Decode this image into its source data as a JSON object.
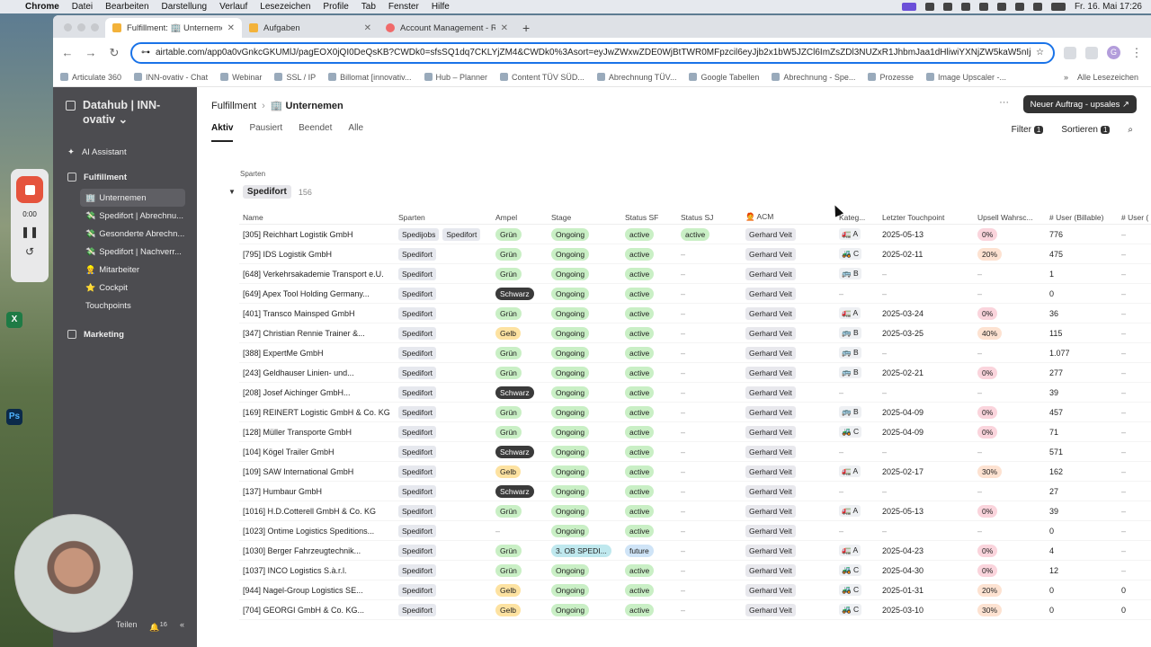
{
  "menubar": {
    "items": [
      "Chrome",
      "Datei",
      "Bearbeiten",
      "Darstellung",
      "Verlauf",
      "Lesezeichen",
      "Profile",
      "Tab",
      "Fenster",
      "Hilfe"
    ],
    "clock": "Fr. 16. Mai 17:26"
  },
  "tabs": [
    {
      "label": "Fulfillment: 🏢 Unternemen"
    },
    {
      "label": "Aufgaben"
    },
    {
      "label": "Account Management - Repo"
    }
  ],
  "url": "airtable.com/app0a0vGnkcGKUMlJ/pagEOX0jQI0DeQsKB?CWDk0=sfsSQ1dq7CKLYjZM4&CWDk0%3Asort=eyJwZWxwZDE0WjBtTWR0MFpzcil6eyJjb2x1bW5JZCl6ImZsZDl3NUZxR1JhbmJaa1dHliwiYXNjZW5kaW5nIjp0c...",
  "bookmarks": [
    "Articulate 360",
    "INN-ovativ - Chat",
    "Webinar",
    "SSL / IP",
    "Billomat [innovativ...",
    "Hub – Planner",
    "Content TÜV SÜD...",
    "Abrechnung TÜV...",
    "Google Tabellen",
    "Abrechnung - Spe...",
    "Prozesse",
    "Image Upscaler -..."
  ],
  "bookmarks_right": "Alle Lesezeichen",
  "sidebar": {
    "workspace": "Datahub | INN-ovativ ⌄",
    "ai": "AI Assistant",
    "fulfillment": "Fulfillment",
    "sub": [
      {
        "icon": "🏢",
        "label": "Unternemen"
      },
      {
        "icon": "💸",
        "label": "Spedifort | Abrechnu..."
      },
      {
        "icon": "💸",
        "label": "Gesonderte Abrechn..."
      },
      {
        "icon": "💸",
        "label": "Spedifort | Nachverr..."
      },
      {
        "icon": "👷",
        "label": "Mitarbeiter"
      },
      {
        "icon": "⭐",
        "label": "Cockpit"
      },
      {
        "icon": "",
        "label": "Touchpoints"
      }
    ],
    "marketing": "Marketing",
    "share": "Teilen",
    "notif_count": "16"
  },
  "recorder": {
    "time": "0:00"
  },
  "header": {
    "crumb1": "Fulfillment",
    "crumb2": "🏢 Unternemen",
    "more": "···",
    "new_button": "Neuer Auftrag - upsales ↗"
  },
  "views": [
    "Aktiv",
    "Pausiert",
    "Beendet",
    "Alle"
  ],
  "tools": {
    "filter": "Filter",
    "filter_count": "1",
    "sort": "Sortieren",
    "sort_count": "1"
  },
  "group": {
    "field": "Sparten",
    "name": "Spedifort",
    "count": "156"
  },
  "columns": [
    "Name",
    "Sparten",
    "Ampel",
    "Stage",
    "Status SF",
    "Status SJ",
    "🧑‍🦰 ACM",
    "Kateg...",
    "Letzter Touchpoint",
    "Upsell Wahrsc...",
    "# User (Billable)",
    "# User ("
  ],
  "rows": [
    {
      "name": "[305] Reichhart Logistik GmbH",
      "sparten": [
        "Spedijobs",
        "Spedifort"
      ],
      "ampel": "Grün",
      "stage": "Ongoing",
      "sf": "active",
      "sj": "active",
      "acm": "Gerhard Veit",
      "kat": "🚛 A",
      "touch": "2025-05-13",
      "upsell": "0%",
      "users": "776",
      "users2": "–"
    },
    {
      "name": "[795] IDS Logistik GmbH",
      "sparten": [
        "Spedifort"
      ],
      "ampel": "Grün",
      "stage": "Ongoing",
      "sf": "active",
      "sj": "–",
      "acm": "Gerhard Veit",
      "kat": "🚜 C",
      "touch": "2025-02-11",
      "upsell": "20%",
      "users": "475",
      "users2": "–"
    },
    {
      "name": "[648] Verkehrsakademie Transport e.U.",
      "sparten": [
        "Spedifort"
      ],
      "ampel": "Grün",
      "stage": "Ongoing",
      "sf": "active",
      "sj": "–",
      "acm": "Gerhard Veit",
      "kat": "🚌 B",
      "touch": "–",
      "upsell": "–",
      "users": "1",
      "users2": "–"
    },
    {
      "name": "[649] Apex Tool Holding Germany...",
      "sparten": [
        "Spedifort"
      ],
      "ampel": "Schwarz",
      "stage": "Ongoing",
      "sf": "active",
      "sj": "–",
      "acm": "Gerhard Veit",
      "kat": "–",
      "touch": "–",
      "upsell": "–",
      "users": "0",
      "users2": "–"
    },
    {
      "name": "[401] Transco Mainsped GmbH",
      "sparten": [
        "Spedifort"
      ],
      "ampel": "Grün",
      "stage": "Ongoing",
      "sf": "active",
      "sj": "–",
      "acm": "Gerhard Veit",
      "kat": "🚛 A",
      "touch": "2025-03-24",
      "upsell": "0%",
      "users": "36",
      "users2": "–"
    },
    {
      "name": "[347] Christian Rennie Trainer &...",
      "sparten": [
        "Spedifort"
      ],
      "ampel": "Gelb",
      "stage": "Ongoing",
      "sf": "active",
      "sj": "–",
      "acm": "Gerhard Veit",
      "kat": "🚌 B",
      "touch": "2025-03-25",
      "upsell": "40%",
      "users": "115",
      "users2": "–"
    },
    {
      "name": "[388] ExpertMe GmbH",
      "sparten": [
        "Spedifort"
      ],
      "ampel": "Grün",
      "stage": "Ongoing",
      "sf": "active",
      "sj": "–",
      "acm": "Gerhard Veit",
      "kat": "🚌 B",
      "touch": "–",
      "upsell": "–",
      "users": "1.077",
      "users2": "–"
    },
    {
      "name": "[243] Geldhauser Linien- und...",
      "sparten": [
        "Spedifort"
      ],
      "ampel": "Grün",
      "stage": "Ongoing",
      "sf": "active",
      "sj": "–",
      "acm": "Gerhard Veit",
      "kat": "🚌 B",
      "touch": "2025-02-21",
      "upsell": "0%",
      "users": "277",
      "users2": "–"
    },
    {
      "name": "[208] Josef Aichinger GmbH...",
      "sparten": [
        "Spedifort"
      ],
      "ampel": "Schwarz",
      "stage": "Ongoing",
      "sf": "active",
      "sj": "–",
      "acm": "Gerhard Veit",
      "kat": "–",
      "touch": "–",
      "upsell": "–",
      "users": "39",
      "users2": "–"
    },
    {
      "name": "[169] REINERT Logistic GmbH & Co. KG",
      "sparten": [
        "Spedifort"
      ],
      "ampel": "Grün",
      "stage": "Ongoing",
      "sf": "active",
      "sj": "–",
      "acm": "Gerhard Veit",
      "kat": "🚌 B",
      "touch": "2025-04-09",
      "upsell": "0%",
      "users": "457",
      "users2": "–"
    },
    {
      "name": "[128] Müller Transporte GmbH",
      "sparten": [
        "Spedifort"
      ],
      "ampel": "Grün",
      "stage": "Ongoing",
      "sf": "active",
      "sj": "–",
      "acm": "Gerhard Veit",
      "kat": "🚜 C",
      "touch": "2025-04-09",
      "upsell": "0%",
      "users": "71",
      "users2": "–"
    },
    {
      "name": "[104] Kögel Trailer GmbH",
      "sparten": [
        "Spedifort"
      ],
      "ampel": "Schwarz",
      "stage": "Ongoing",
      "sf": "active",
      "sj": "–",
      "acm": "Gerhard Veit",
      "kat": "–",
      "touch": "–",
      "upsell": "–",
      "users": "571",
      "users2": "–"
    },
    {
      "name": "[109] SAW International GmbH",
      "sparten": [
        "Spedifort"
      ],
      "ampel": "Gelb",
      "stage": "Ongoing",
      "sf": "active",
      "sj": "–",
      "acm": "Gerhard Veit",
      "kat": "🚛 A",
      "touch": "2025-02-17",
      "upsell": "30%",
      "users": "162",
      "users2": "–"
    },
    {
      "name": "[137] Humbaur GmbH",
      "sparten": [
        "Spedifort"
      ],
      "ampel": "Schwarz",
      "stage": "Ongoing",
      "sf": "active",
      "sj": "–",
      "acm": "Gerhard Veit",
      "kat": "–",
      "touch": "–",
      "upsell": "–",
      "users": "27",
      "users2": "–"
    },
    {
      "name": "[1016] H.D.Cotterell GmbH & Co. KG",
      "sparten": [
        "Spedifort"
      ],
      "ampel": "Grün",
      "stage": "Ongoing",
      "sf": "active",
      "sj": "–",
      "acm": "Gerhard Veit",
      "kat": "🚛 A",
      "touch": "2025-05-13",
      "upsell": "0%",
      "users": "39",
      "users2": "–"
    },
    {
      "name": "[1023] Ontime Logistics Speditions...",
      "sparten": [
        "Spedifort"
      ],
      "ampel": "–",
      "stage": "Ongoing",
      "sf": "active",
      "sj": "–",
      "acm": "Gerhard Veit",
      "kat": "–",
      "touch": "–",
      "upsell": "–",
      "users": "0",
      "users2": "–"
    },
    {
      "name": "[1030] Berger Fahrzeugtechnik...",
      "sparten": [
        "Spedifort"
      ],
      "ampel": "Grün",
      "stage": "3. OB SPEDI...",
      "sf": "future",
      "sj": "–",
      "acm": "Gerhard Veit",
      "kat": "🚛 A",
      "touch": "2025-04-23",
      "upsell": "0%",
      "users": "4",
      "users2": "–"
    },
    {
      "name": "[1037] INCO Logistics S.à.r.l.",
      "sparten": [
        "Spedifort"
      ],
      "ampel": "Grün",
      "stage": "Ongoing",
      "sf": "active",
      "sj": "–",
      "acm": "Gerhard Veit",
      "kat": "🚜 C",
      "touch": "2025-04-30",
      "upsell": "0%",
      "users": "12",
      "users2": "–"
    },
    {
      "name": "[944] Nagel-Group Logistics SE...",
      "sparten": [
        "Spedifort"
      ],
      "ampel": "Gelb",
      "stage": "Ongoing",
      "sf": "active",
      "sj": "–",
      "acm": "Gerhard Veit",
      "kat": "🚜 C",
      "touch": "2025-01-31",
      "upsell": "20%",
      "users": "0",
      "users2": "0"
    },
    {
      "name": "[704] GEORGI GmbH & Co. KG...",
      "sparten": [
        "Spedifort"
      ],
      "ampel": "Gelb",
      "stage": "Ongoing",
      "sf": "active",
      "sj": "–",
      "acm": "Gerhard Veit",
      "kat": "🚜 C",
      "touch": "2025-03-10",
      "upsell": "30%",
      "users": "0",
      "users2": "0"
    }
  ]
}
